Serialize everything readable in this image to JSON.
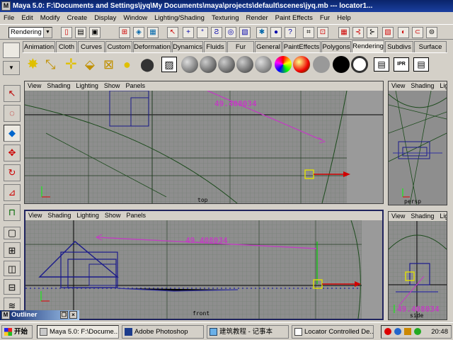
{
  "window": {
    "title": "Maya 5.0: F:\\Documents and Settings\\jyq\\My Documents\\maya\\projects\\default\\scenes\\jyq.mb   ---   locator1..."
  },
  "menu": [
    "File",
    "Edit",
    "Modify",
    "Create",
    "Display",
    "Window",
    "Lighting/Shading",
    "Texturing",
    "Render",
    "Paint Effects",
    "Fur",
    "Help"
  ],
  "statusline": {
    "menuset": "Rendering"
  },
  "shelf_tabs": [
    "Animation",
    "Cloth",
    "Curves",
    "Custom",
    "Deformation",
    "Dynamics",
    "Fluids",
    "Fur",
    "General",
    "PaintEffects",
    "Polygons",
    "Rendering",
    "Subdivs",
    "Surface"
  ],
  "active_shelf_tab": "Rendering",
  "viewport_menu": [
    "View",
    "Shading",
    "Lighting",
    "Show",
    "Panels"
  ],
  "viewports": {
    "top": {
      "camera_label": "top",
      "dimension": "49.408034"
    },
    "persp": {
      "camera_label": "persp"
    },
    "front": {
      "camera_label": "front",
      "dimension": "49.408034"
    },
    "side": {
      "camera_label": "side",
      "dimension": "49.408034"
    }
  },
  "outliner": {
    "title": "Outliner"
  },
  "taskbar": {
    "start": "开始",
    "items": [
      "Maya 5.0: F:\\Docume...",
      "Adobe Photoshop",
      "建筑教程 - 记事本",
      "Locator Controlled De..."
    ],
    "clock": "20:48"
  },
  "colors": {
    "title_bar": "#0a246a",
    "viewport_bg": "#8e8e8e",
    "grid": "#5f6d5f",
    "dimension": "#c040c0",
    "geometry": "#1a1a8a"
  }
}
